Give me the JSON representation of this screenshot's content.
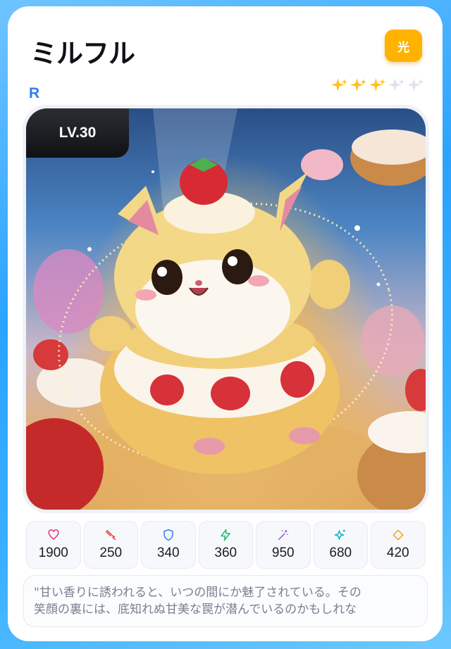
{
  "card": {
    "name": "ミルフル",
    "attribute": "光",
    "rarity": "R",
    "stars_filled": 3,
    "stars_total": 5,
    "level": "LV.30",
    "colors": {
      "attribute_badge": "#ffb300",
      "rarity_text": "#2f7df0",
      "star_filled": "#ffc11a",
      "star_empty": "#dde3ec",
      "frame": "#2aa3ff"
    }
  },
  "stats": [
    {
      "icon": "heart-icon",
      "color": "#e0337a",
      "value": "1900"
    },
    {
      "icon": "sword-icon",
      "color": "#e53935",
      "value": "250"
    },
    {
      "icon": "shield-icon",
      "color": "#2f7df0",
      "value": "340"
    },
    {
      "icon": "lightning-icon",
      "color": "#1fbf6b",
      "value": "360"
    },
    {
      "icon": "magic-wand-icon",
      "color": "#a24fe0",
      "value": "950"
    },
    {
      "icon": "sparkle-icon",
      "color": "#19b3c9",
      "value": "680"
    },
    {
      "icon": "diamond-icon",
      "color": "#f0a020",
      "value": "420"
    }
  ],
  "description": {
    "line1": "\"甘い香りに誘われると、いつの間にか魅了されている。その",
    "line2": "笑顔の裏には、底知れぬ甘美な罠が潜んでいるのかもしれな"
  }
}
